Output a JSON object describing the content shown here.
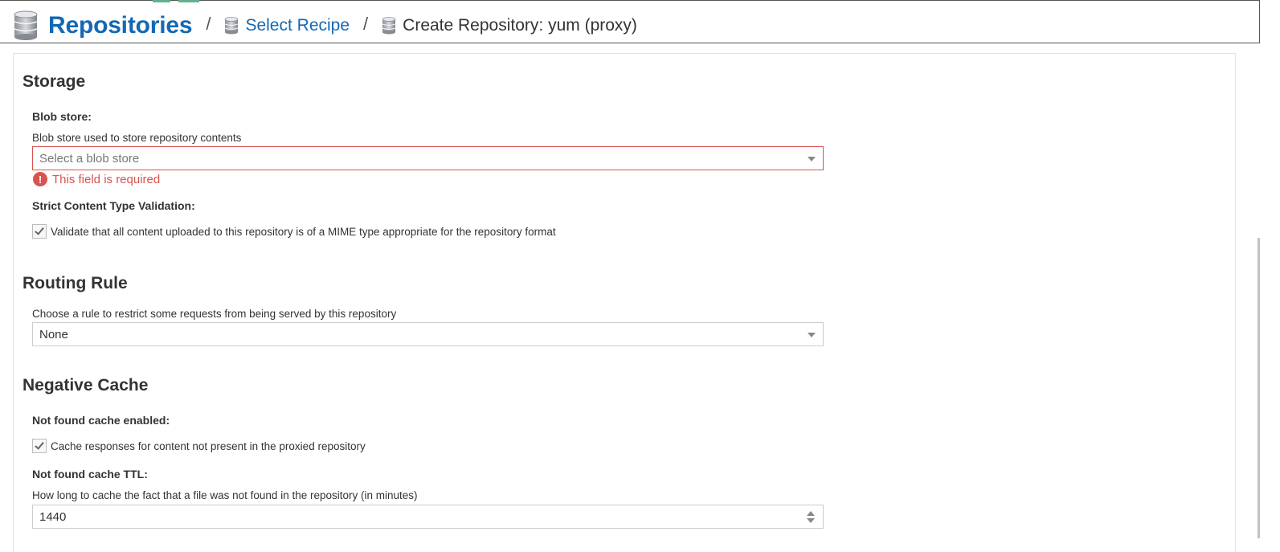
{
  "breadcrumb": {
    "root_label": "Repositories",
    "separator": "/",
    "select_recipe_label": "Select Recipe",
    "current_label": "Create Repository: yum (proxy)",
    "icon": "database-icon",
    "link_color": "#1468b3"
  },
  "storage": {
    "title": "Storage",
    "blob_store": {
      "label": "Blob store:",
      "help": "Blob store used to store repository contents",
      "placeholder": "Select a blob store",
      "value": "",
      "error": "This field is required",
      "error_color": "#d9534f"
    },
    "strict_validation": {
      "label": "Strict Content Type Validation:",
      "checkbox_label": "Validate that all content uploaded to this repository is of a MIME type appropriate for the repository format",
      "checked": true
    }
  },
  "routing_rule": {
    "title": "Routing Rule",
    "help": "Choose a rule to restrict some requests from being served by this repository",
    "value": "None"
  },
  "negative_cache": {
    "title": "Negative Cache",
    "enabled": {
      "label": "Not found cache enabled:",
      "checkbox_label": "Cache responses for content not present in the proxied repository",
      "checked": true
    },
    "ttl": {
      "label": "Not found cache TTL:",
      "help": "How long to cache the fact that a file was not found in the repository (in minutes)",
      "value": "1440"
    }
  }
}
